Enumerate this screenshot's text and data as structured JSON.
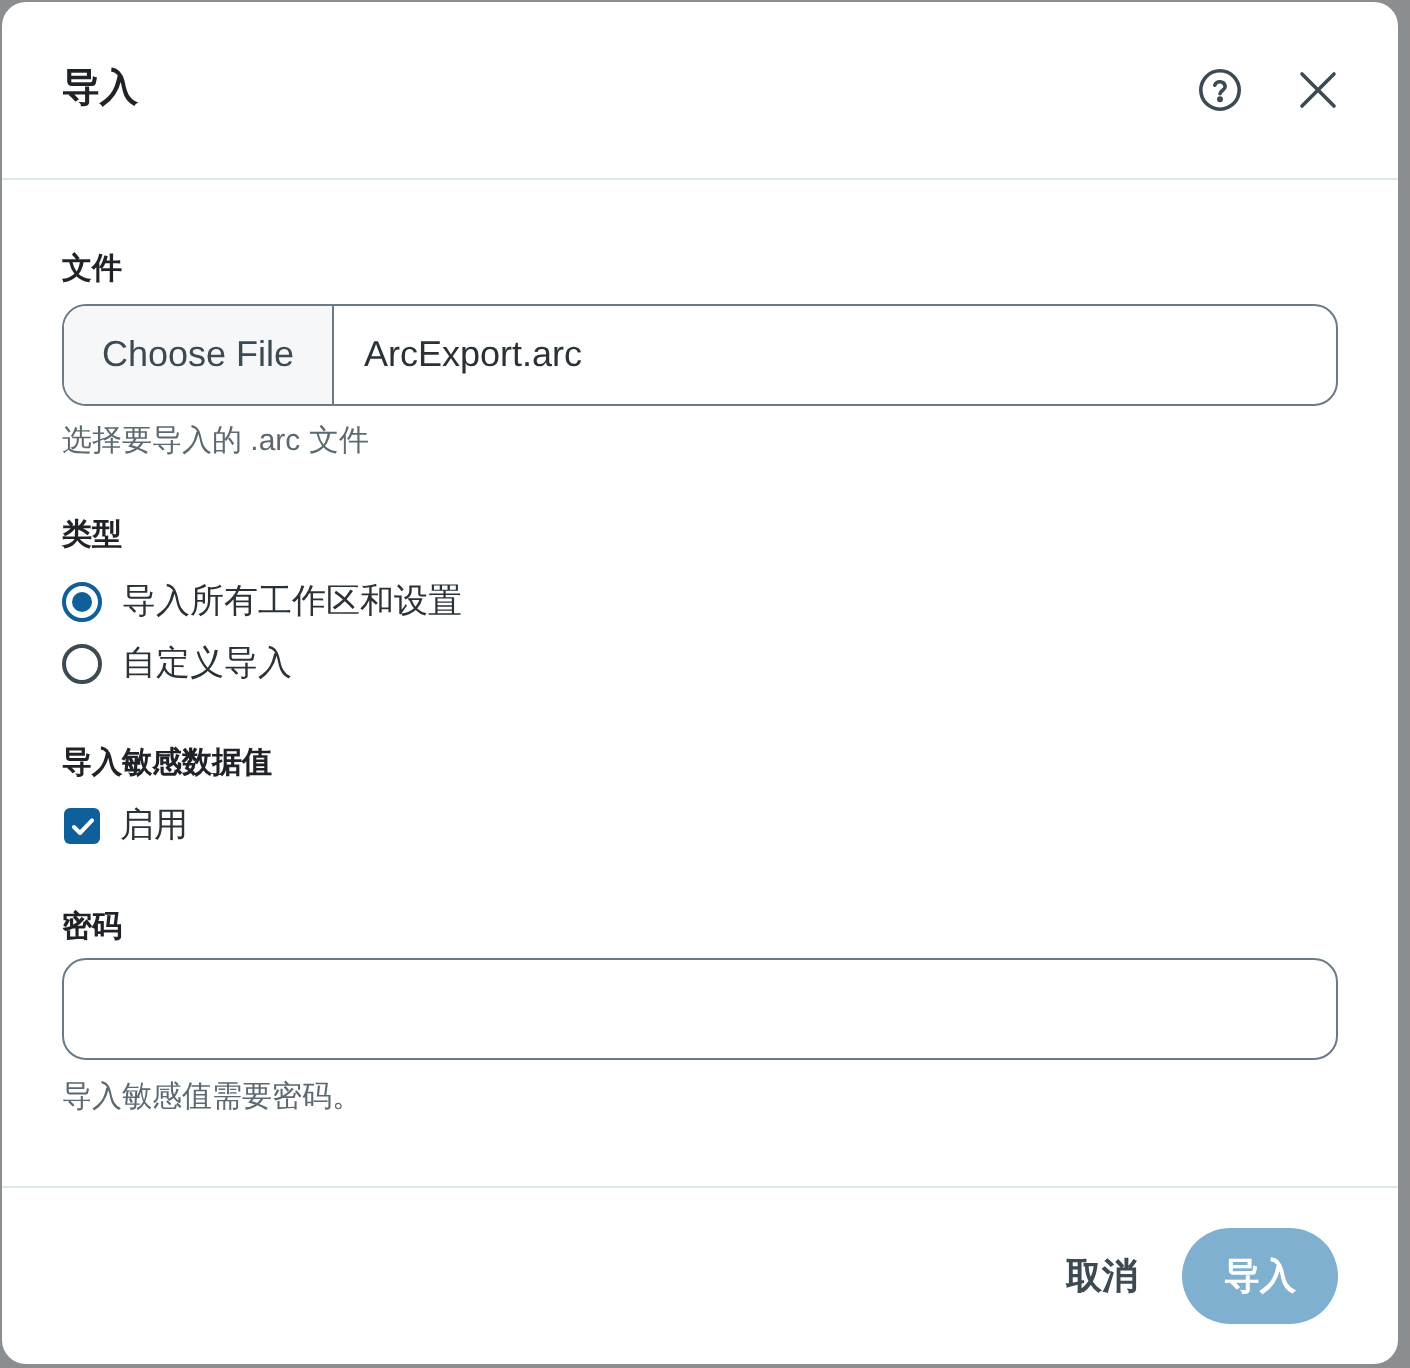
{
  "dialog": {
    "title": "导入"
  },
  "file": {
    "label": "文件",
    "button": "Choose File",
    "value": "ArcExport.arc",
    "hint": "选择要导入的 .arc 文件"
  },
  "type": {
    "label": "类型",
    "options": [
      {
        "label": "导入所有工作区和设置",
        "selected": true
      },
      {
        "label": "自定义导入",
        "selected": false
      }
    ]
  },
  "sensitive": {
    "label": "导入敏感数据值",
    "checkbox": {
      "label": "启用",
      "checked": true
    }
  },
  "password": {
    "label": "密码",
    "hint": "导入敏感值需要密码。"
  },
  "footer": {
    "buttons": [
      {
        "label": "取消",
        "kind": "text",
        "disabled": false
      },
      {
        "label": "导入",
        "kind": "primary",
        "disabled": true
      }
    ]
  }
}
